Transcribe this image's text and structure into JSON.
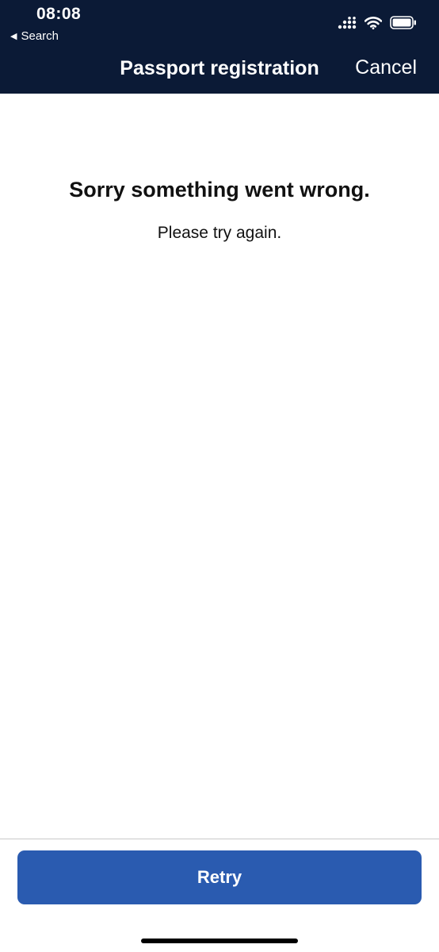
{
  "status_bar": {
    "time": "08:08",
    "back_app_label": "Search"
  },
  "nav_bar": {
    "title": "Passport registration",
    "cancel_label": "Cancel"
  },
  "error": {
    "heading": "Sorry something went wrong.",
    "message": "Please try again."
  },
  "footer": {
    "retry_label": "Retry"
  },
  "icons": {
    "back_app": "back-triangle-icon",
    "signal": "cellular-signal-icon",
    "wifi": "wifi-icon",
    "battery": "battery-icon"
  },
  "colors": {
    "header_background": "#0b1a36",
    "button_background": "#2a5bb0"
  }
}
